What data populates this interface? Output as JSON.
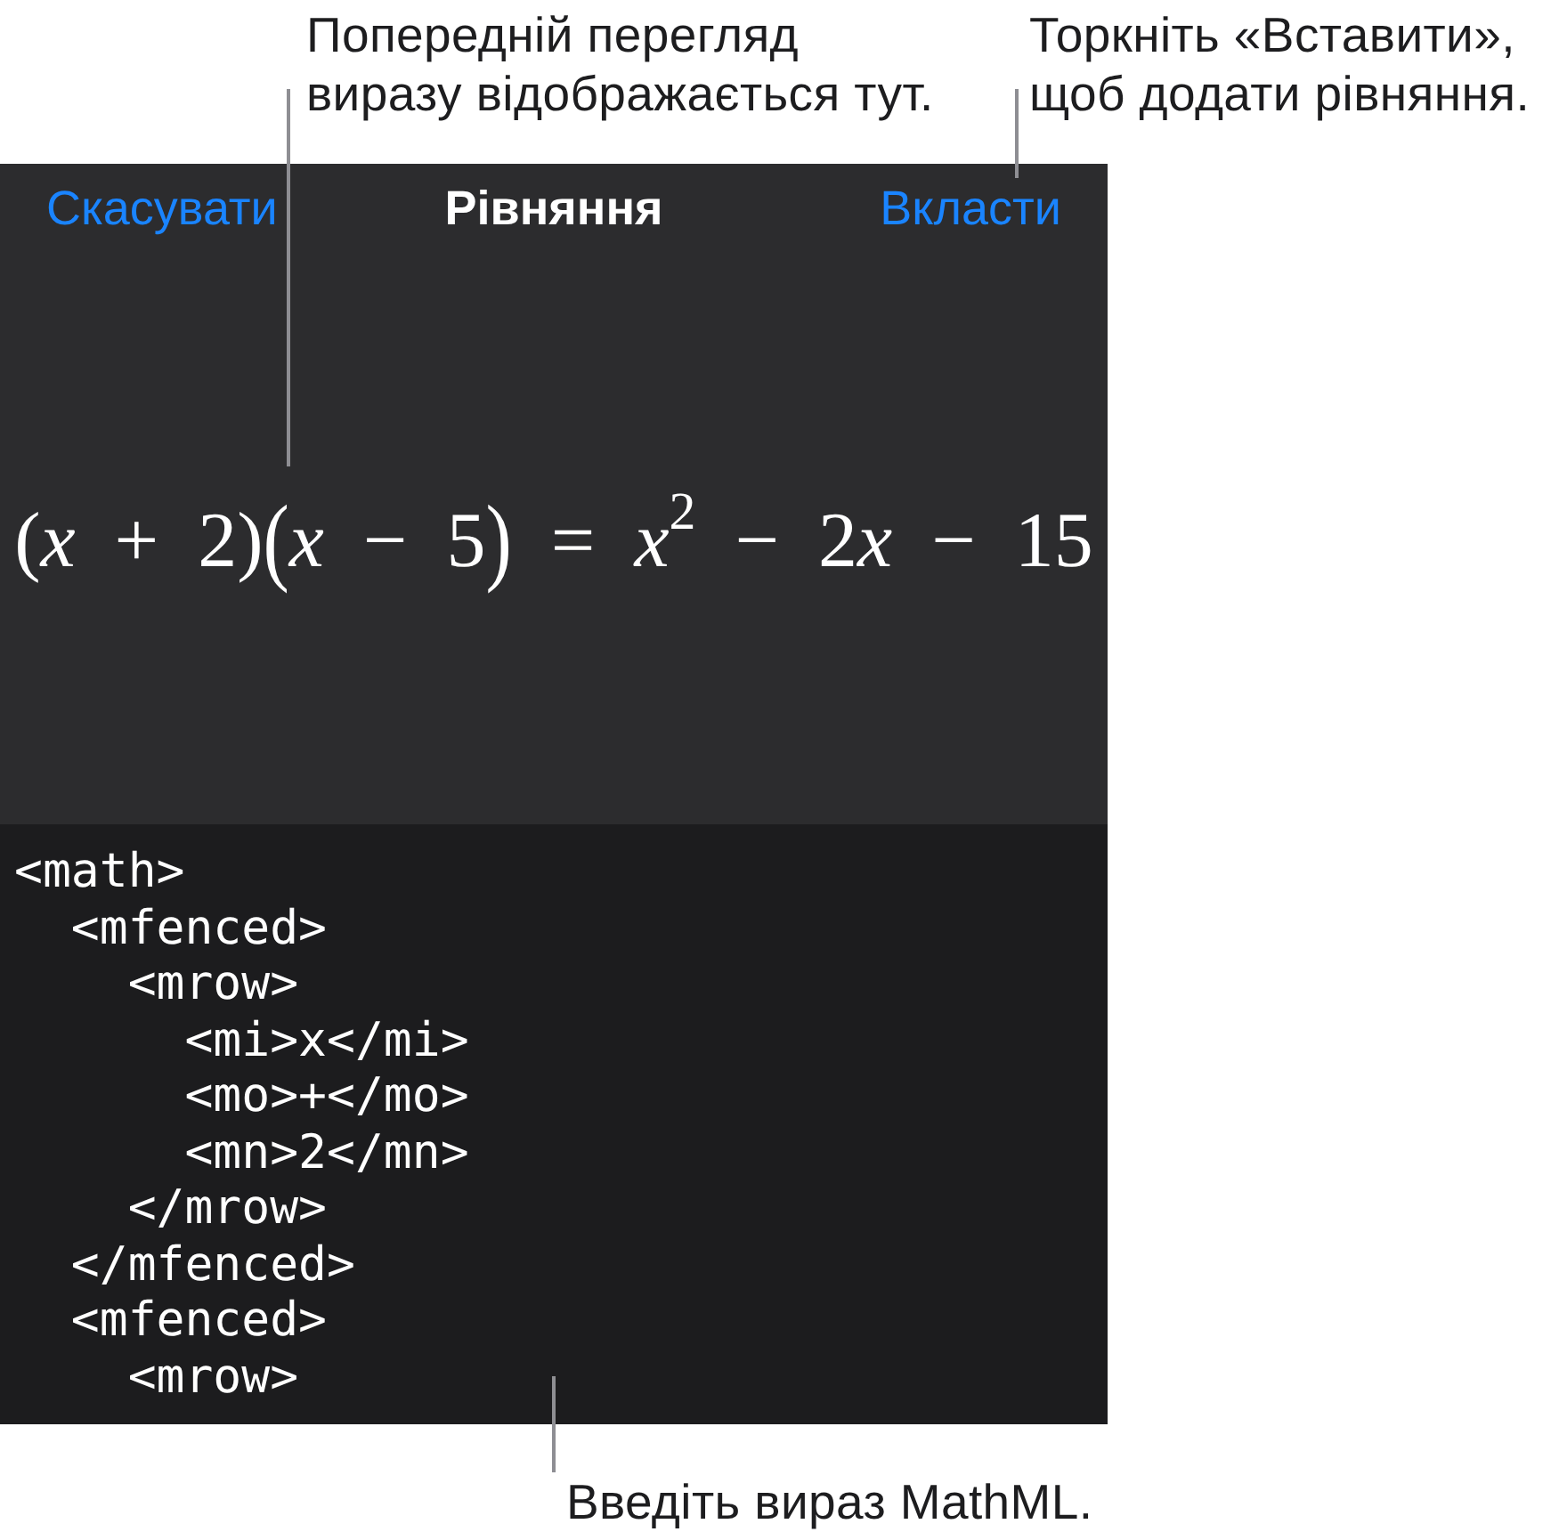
{
  "callouts_top": [
    {
      "lines": [
        "Попередній перегляд",
        "виразу відображається тут."
      ]
    },
    {
      "lines": [
        "Торкніть «Вставити»,",
        "щоб додати рівняння."
      ]
    }
  ],
  "nav_bar": {
    "cancel": "Скасувати",
    "title": "Рівняння",
    "insert": "Вкласти"
  },
  "preview": {
    "equation": [
      {
        "kind": "text",
        "text": "("
      },
      {
        "kind": "var",
        "text": "x"
      },
      {
        "kind": "text",
        "text": " + 2)"
      },
      {
        "kind": "fence",
        "text": "("
      },
      {
        "kind": "var",
        "text": "x"
      },
      {
        "kind": "text",
        "text": " − 5"
      },
      {
        "kind": "fence",
        "text": ")"
      },
      {
        "kind": "text",
        "text": " = "
      },
      {
        "kind": "var",
        "text": "x"
      },
      {
        "kind": "sup",
        "text": "2"
      },
      {
        "kind": "text",
        "text": " − 2"
      },
      {
        "kind": "var",
        "text": "x"
      },
      {
        "kind": "text",
        "text": " − 15"
      }
    ]
  },
  "editor": {
    "lines": [
      "<math>",
      "  <mfenced>",
      "    <mrow>",
      "      <mi>x</mi>",
      "      <mo>+</mo>",
      "      <mn>2</mn>",
      "    </mrow>",
      "  </mfenced>",
      "  <mfenced>",
      "    <mrow>"
    ]
  },
  "callout_bottom": {
    "lines": [
      "Введіть вираз MathML."
    ]
  }
}
